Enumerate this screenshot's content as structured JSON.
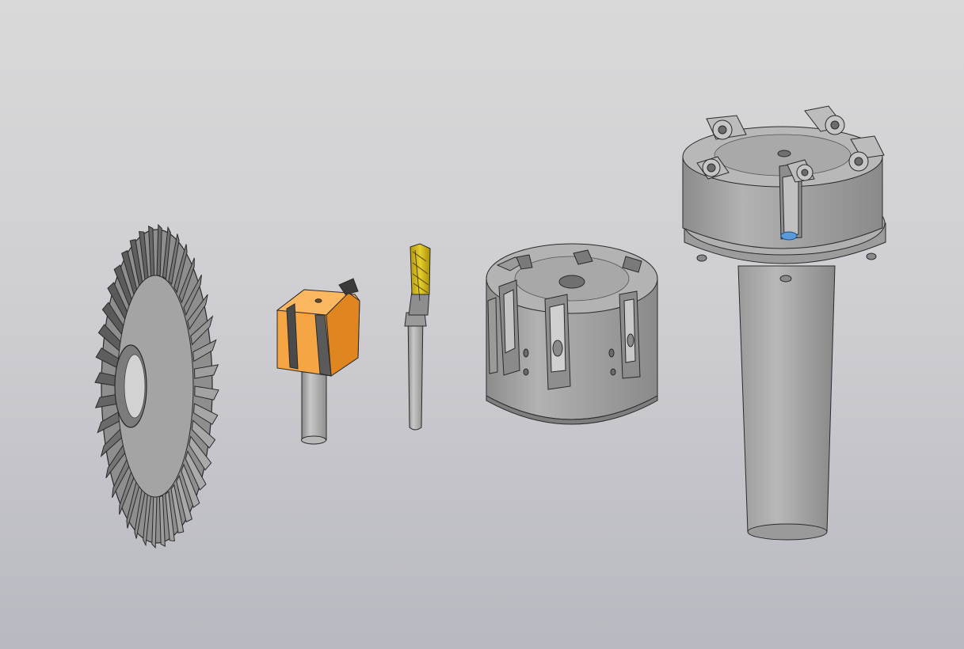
{
  "scene": {
    "background_top": "#d9d9d9",
    "background_bottom": "#b8b8c0",
    "models": [
      {
        "id": "disc-cutter",
        "color": "#9e9e9e"
      },
      {
        "id": "router-bit",
        "color": "#f39a2b"
      },
      {
        "id": "end-mill",
        "color": "#d9c020"
      },
      {
        "id": "face-mill",
        "color": "#a3a3a3"
      },
      {
        "id": "taper-shank-holder",
        "color": "#a0a0a0"
      }
    ]
  }
}
